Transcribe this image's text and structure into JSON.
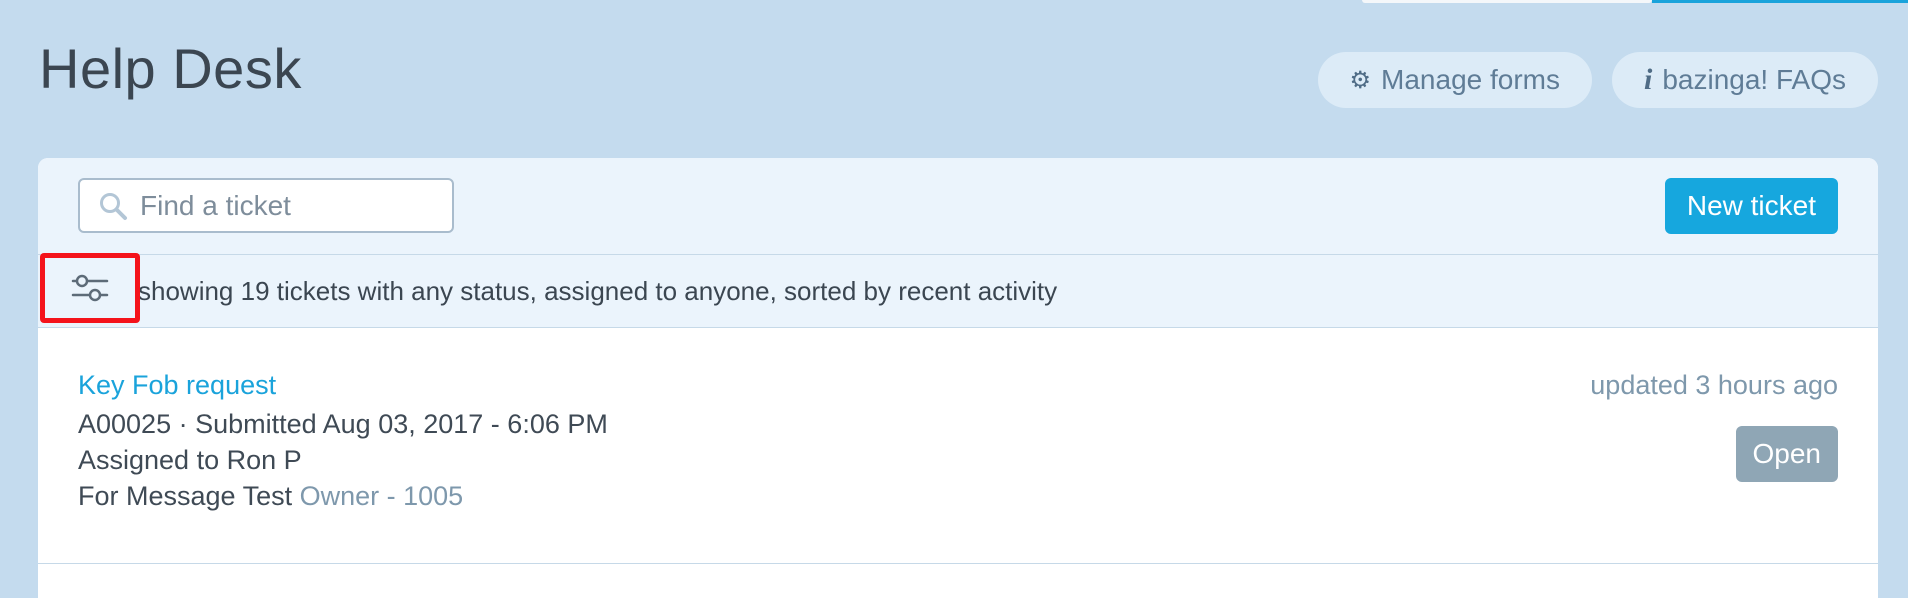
{
  "header": {
    "title": "Help Desk",
    "manage_forms_label": "Manage forms",
    "faqs_icon_text": "i",
    "faqs_label": "bazinga! FAQs"
  },
  "toolbar": {
    "search_placeholder": "Find a ticket",
    "search_value": "",
    "new_ticket_label": "New ticket"
  },
  "filter": {
    "summary": "showing 19 tickets with any status, assigned to anyone, sorted by recent activity"
  },
  "tickets": [
    {
      "title": "Key Fob request",
      "updated": "updated 3 hours ago",
      "meta_line1": "A00025 · Submitted Aug 03, 2017 - 6:06 PM",
      "meta_line2": "Assigned to Ron P",
      "for_prefix": "For Message Test",
      "owner_link": "Owner - 1005",
      "status": "Open"
    }
  ],
  "colors": {
    "background": "#c4dbee",
    "accent": "#16a7de",
    "highlight": "#f4131b",
    "status_open": "#8fa6b5"
  }
}
